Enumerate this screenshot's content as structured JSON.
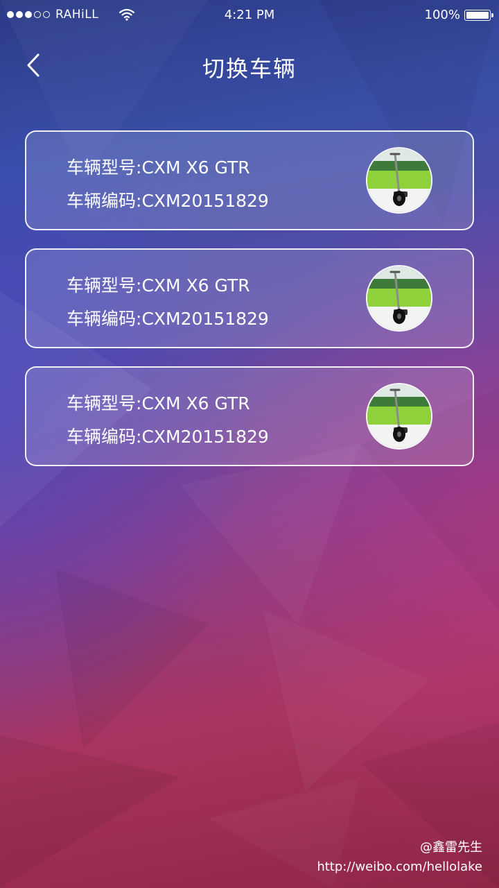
{
  "status_bar": {
    "carrier": "RAHiLL",
    "signal_strength": 3,
    "signal_max": 5,
    "time": "4:21 PM",
    "battery": "100%"
  },
  "nav": {
    "back_icon": "chevron-left-icon",
    "title": "切换车辆"
  },
  "vehicles": [
    {
      "model_label": "车辆型号:",
      "model": "CXM X6 GTR",
      "code_label": "车辆编码:",
      "code": "CXM20151829"
    },
    {
      "model_label": "车辆型号:",
      "model": "CXM X6 GTR",
      "code_label": "车辆编码:",
      "code": "CXM20151829"
    },
    {
      "model_label": "车辆型号:",
      "model": "CXM X6 GTR",
      "code_label": "车辆编码:",
      "code": "CXM20151829"
    }
  ],
  "watermark": {
    "author": "@鑫雷先生",
    "url": "http://weibo.com/hellolake"
  },
  "colors": {
    "gradient_top": "#2b3a86",
    "gradient_mid": "#8a3e8e",
    "gradient_bottom": "#8f2646",
    "card_border": "#ffffff"
  }
}
